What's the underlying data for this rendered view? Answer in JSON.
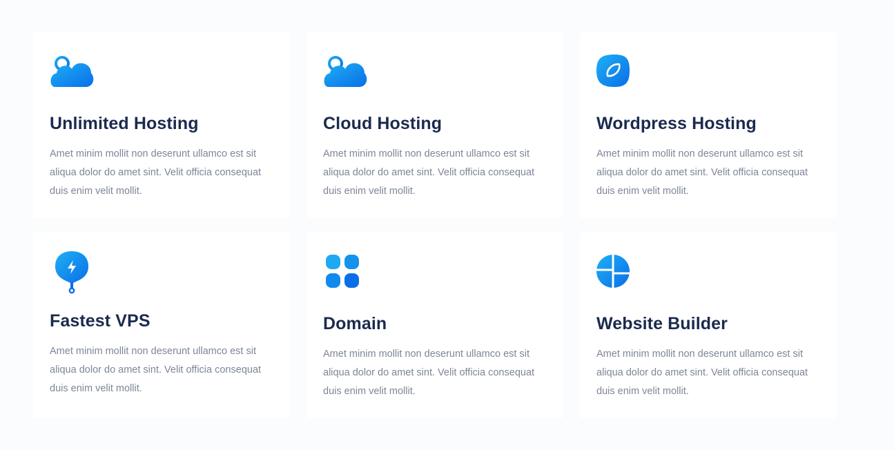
{
  "colors": {
    "background": "#fbfcfe",
    "card": "#ffffff",
    "title": "#1b2a4e",
    "text": "#7d8597",
    "icon_gradient_start": "#1fb0f4",
    "icon_gradient_end": "#0a6ee8"
  },
  "features": [
    {
      "icon": "cloud-icon",
      "title": "Unlimited Hosting",
      "description": "Amet minim mollit non deserunt ullamco est sit aliqua dolor do amet sint. Velit officia consequat duis enim velit mollit."
    },
    {
      "icon": "cloud-icon",
      "title": "Cloud Hosting",
      "description": "Amet minim mollit non deserunt ullamco est sit aliqua dolor do amet sint. Velit officia consequat duis enim velit mollit."
    },
    {
      "icon": "leaf-icon",
      "title": "Wordpress Hosting",
      "description": "Amet minim mollit non deserunt ullamco est sit aliqua dolor do amet sint. Velit officia consequat duis enim velit mollit."
    },
    {
      "icon": "lightning-bulb-icon",
      "title": "Fastest VPS",
      "description": "Amet minim mollit non deserunt ullamco est sit aliqua dolor do amet sint. Velit officia consequat duis enim velit mollit."
    },
    {
      "icon": "grid-icon",
      "title": "Domain",
      "description": "Amet minim mollit non deserunt ullamco est sit aliqua dolor do amet sint. Velit officia consequat duis enim velit mollit."
    },
    {
      "icon": "pie-chart-icon",
      "title": "Website Builder",
      "description": "Amet minim mollit non deserunt ullamco est sit aliqua dolor do amet sint. Velit officia consequat duis enim velit mollit."
    }
  ]
}
